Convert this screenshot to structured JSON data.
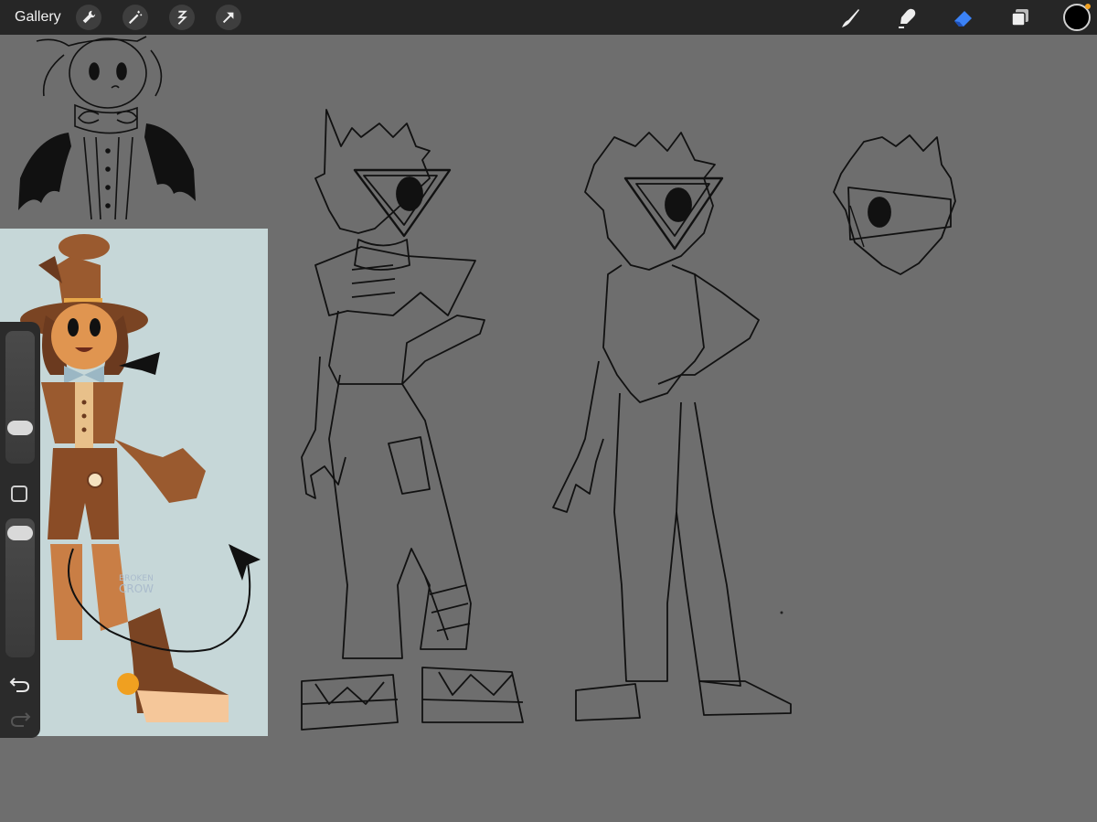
{
  "topbar": {
    "gallery_label": "Gallery",
    "left_tools": [
      "wrench-icon",
      "magic-wand-icon",
      "selection-icon",
      "transform-arrow-icon"
    ],
    "right_tools": [
      "brush-icon",
      "smudge-icon",
      "eraser-icon",
      "layers-icon"
    ],
    "active_tool": "eraser",
    "active_tool_color": "#3b82f6",
    "current_color": "#000000"
  },
  "sidebar": {
    "brush_size": 0.72,
    "opacity": 0.93,
    "controls": [
      "brush-size-slider",
      "modify-button",
      "opacity-slider",
      "undo-button",
      "redo-button"
    ]
  },
  "canvas": {
    "background_color": "#6e6e6e",
    "reference_background": "#c6d7d8",
    "reference_watermark_line1": "BROKEN",
    "reference_watermark_line2": "CROW"
  }
}
